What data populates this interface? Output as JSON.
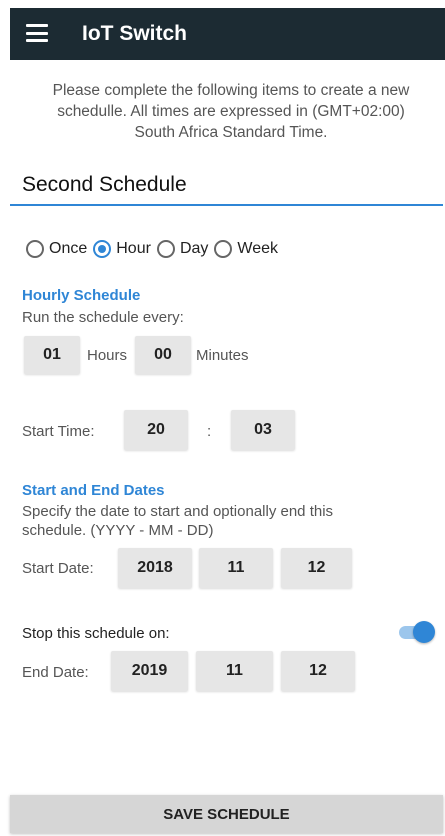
{
  "app": {
    "title": "IoT Switch"
  },
  "intro": {
    "line1": "Please complete the following items to create a new",
    "line2": "schedulle. All times are expressed in (GMT+02:00)",
    "line3": "South Africa Standard Time."
  },
  "schedule_name": {
    "value": "Second Schedule"
  },
  "frequency": {
    "options": [
      "Once",
      "Hour",
      "Day",
      "Week"
    ],
    "selected": "Hour"
  },
  "hourly": {
    "title": "Hourly Schedule",
    "caption": "Run the schedule every:",
    "hours_value": "01",
    "hours_label": "Hours",
    "minutes_value": "00",
    "minutes_label": "Minutes"
  },
  "start_time": {
    "label": "Start Time:",
    "hour": "20",
    "separator": ":",
    "minute": "03"
  },
  "dates": {
    "title": "Start and End Dates",
    "caption_line1": "Specify the date to start and optionally end this",
    "caption_line2": "schedule. (YYYY - MM - DD)",
    "start_label": "Start Date:",
    "start_year": "2018",
    "start_month": "11",
    "start_day": "12",
    "stop_label": "Stop this schedule on:",
    "stop_enabled": true,
    "end_label": "End Date:",
    "end_year": "2019",
    "end_month": "11",
    "end_day": "12"
  },
  "actions": {
    "save_label": "SAVE SCHEDULE"
  },
  "colors": {
    "appbar": "#1c2b33",
    "accent": "#2f86d6",
    "field_bg": "#e6e6e6",
    "button_bg": "#d6d6d6"
  },
  "icons": {
    "menu": "hamburger-menu-icon"
  }
}
